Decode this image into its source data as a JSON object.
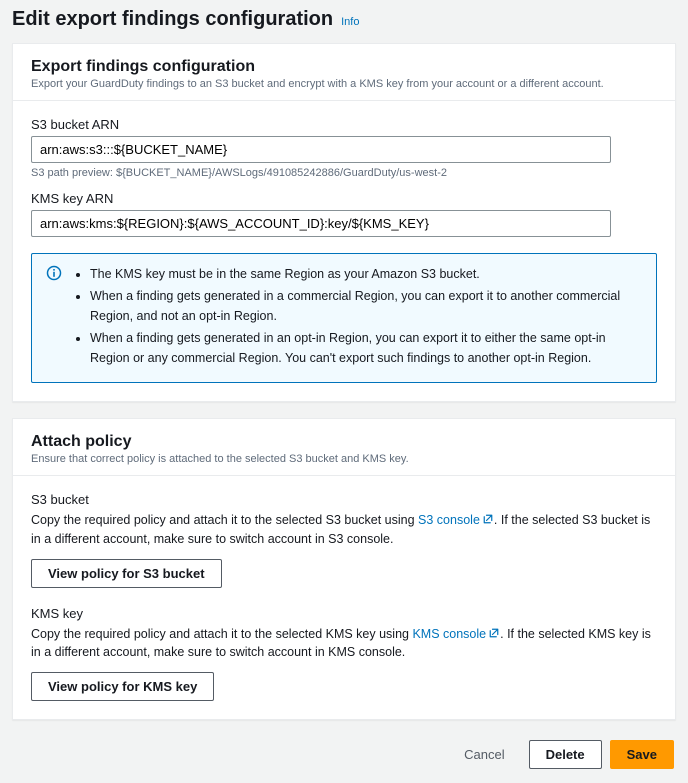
{
  "header": {
    "title": "Edit export findings configuration",
    "info_label": "Info"
  },
  "export_panel": {
    "title": "Export findings configuration",
    "subtitle": "Export your GuardDuty findings to an S3 bucket and encrypt with a KMS key from your account or a different account.",
    "s3_label": "S3 bucket ARN",
    "s3_value": "arn:aws:s3:::${BUCKET_NAME}",
    "s3_hint": "S3 path preview: ${BUCKET_NAME}/AWSLogs/491085242886/GuardDuty/us-west-2",
    "kms_label": "KMS key ARN",
    "kms_value": "arn:aws:kms:${REGION}:${AWS_ACCOUNT_ID}:key/${KMS_KEY}",
    "info_items": [
      "The KMS key must be in the same Region as your Amazon S3 bucket.",
      "When a finding gets generated in a commercial Region, you can export it to another commercial Region, and not an opt-in Region.",
      "When a finding gets generated in an opt-in Region, you can export it to either the same opt-in Region or any commercial Region. You can't export such findings to another opt-in Region."
    ]
  },
  "attach_panel": {
    "title": "Attach policy",
    "subtitle": "Ensure that correct policy is attached to the selected S3 bucket and KMS key.",
    "s3": {
      "label": "S3 bucket",
      "desc_before": "Copy the required policy and attach it to the selected S3 bucket using ",
      "link_text": "S3 console",
      "desc_after": ". If the selected S3 bucket is in a different account, make sure to switch account in S3 console.",
      "button": "View policy for S3 bucket"
    },
    "kms": {
      "label": "KMS key",
      "desc_before": "Copy the required policy and attach it to the selected KMS key using ",
      "link_text": "KMS console",
      "desc_after": ". If the selected KMS key is in a different account, make sure to switch account in KMS console.",
      "button": "View policy for KMS key"
    }
  },
  "actions": {
    "cancel": "Cancel",
    "delete": "Delete",
    "save": "Save"
  }
}
